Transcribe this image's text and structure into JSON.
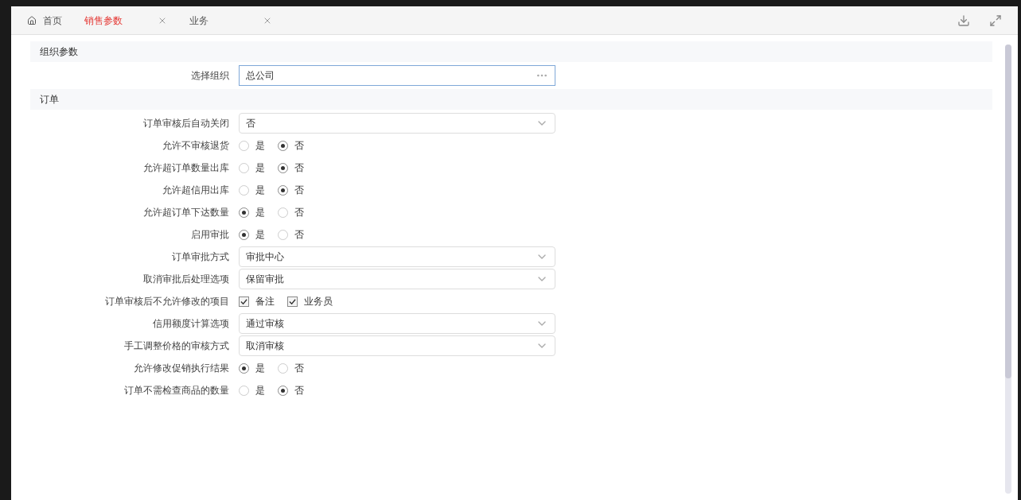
{
  "tabs": [
    {
      "label": "首页",
      "selected": false,
      "closable": false
    },
    {
      "label": "销售参数",
      "selected": true,
      "closable": true
    },
    {
      "label": "业务",
      "selected": false,
      "closable": true
    }
  ],
  "sections": [
    {
      "title": "组织参数",
      "rows": [
        {
          "kind": "field",
          "label": "选择组织",
          "value": "总公司"
        }
      ]
    },
    {
      "title": "订单",
      "rows": [
        {
          "kind": "select",
          "label": "订单审核后自动关闭",
          "value": "否"
        },
        {
          "kind": "radio",
          "label": "允许不审核退货",
          "options": [
            {
              "label": "是",
              "selected": false
            },
            {
              "label": "否",
              "selected": true
            }
          ]
        },
        {
          "kind": "radio",
          "label": "允许超订单数量出库",
          "options": [
            {
              "label": "是",
              "selected": false
            },
            {
              "label": "否",
              "selected": true
            }
          ]
        },
        {
          "kind": "radio",
          "label": "允许超信用出库",
          "options": [
            {
              "label": "是",
              "selected": false
            },
            {
              "label": "否",
              "selected": true
            }
          ]
        },
        {
          "kind": "radio",
          "label": "允许超订单下达数量",
          "options": [
            {
              "label": "是",
              "selected": true
            },
            {
              "label": "否",
              "selected": false
            }
          ]
        },
        {
          "kind": "radio",
          "label": "启用审批",
          "options": [
            {
              "label": "是",
              "selected": true
            },
            {
              "label": "否",
              "selected": false
            }
          ]
        },
        {
          "kind": "select",
          "label": "订单审批方式",
          "value": "审批中心"
        },
        {
          "kind": "select",
          "label": "取消审批后处理选项",
          "value": "保留审批"
        },
        {
          "kind": "checks",
          "label": "订单审核后不允许修改的项目",
          "options": [
            {
              "label": "备注",
              "checked": true
            },
            {
              "label": "业务员",
              "checked": true
            }
          ]
        },
        {
          "kind": "select",
          "label": "信用额度计算选项",
          "value": "通过审核"
        },
        {
          "kind": "select",
          "label": "手工调整价格的审核方式",
          "value": "取消审核"
        },
        {
          "kind": "radio",
          "label": "允许修改促销执行结果",
          "options": [
            {
              "label": "是",
              "selected": true
            },
            {
              "label": "否",
              "selected": false
            }
          ]
        },
        {
          "kind": "radio",
          "label": "订单不需检查商品的数量",
          "options": [
            {
              "label": "是",
              "selected": false
            },
            {
              "label": "否",
              "selected": true
            }
          ]
        }
      ]
    }
  ]
}
